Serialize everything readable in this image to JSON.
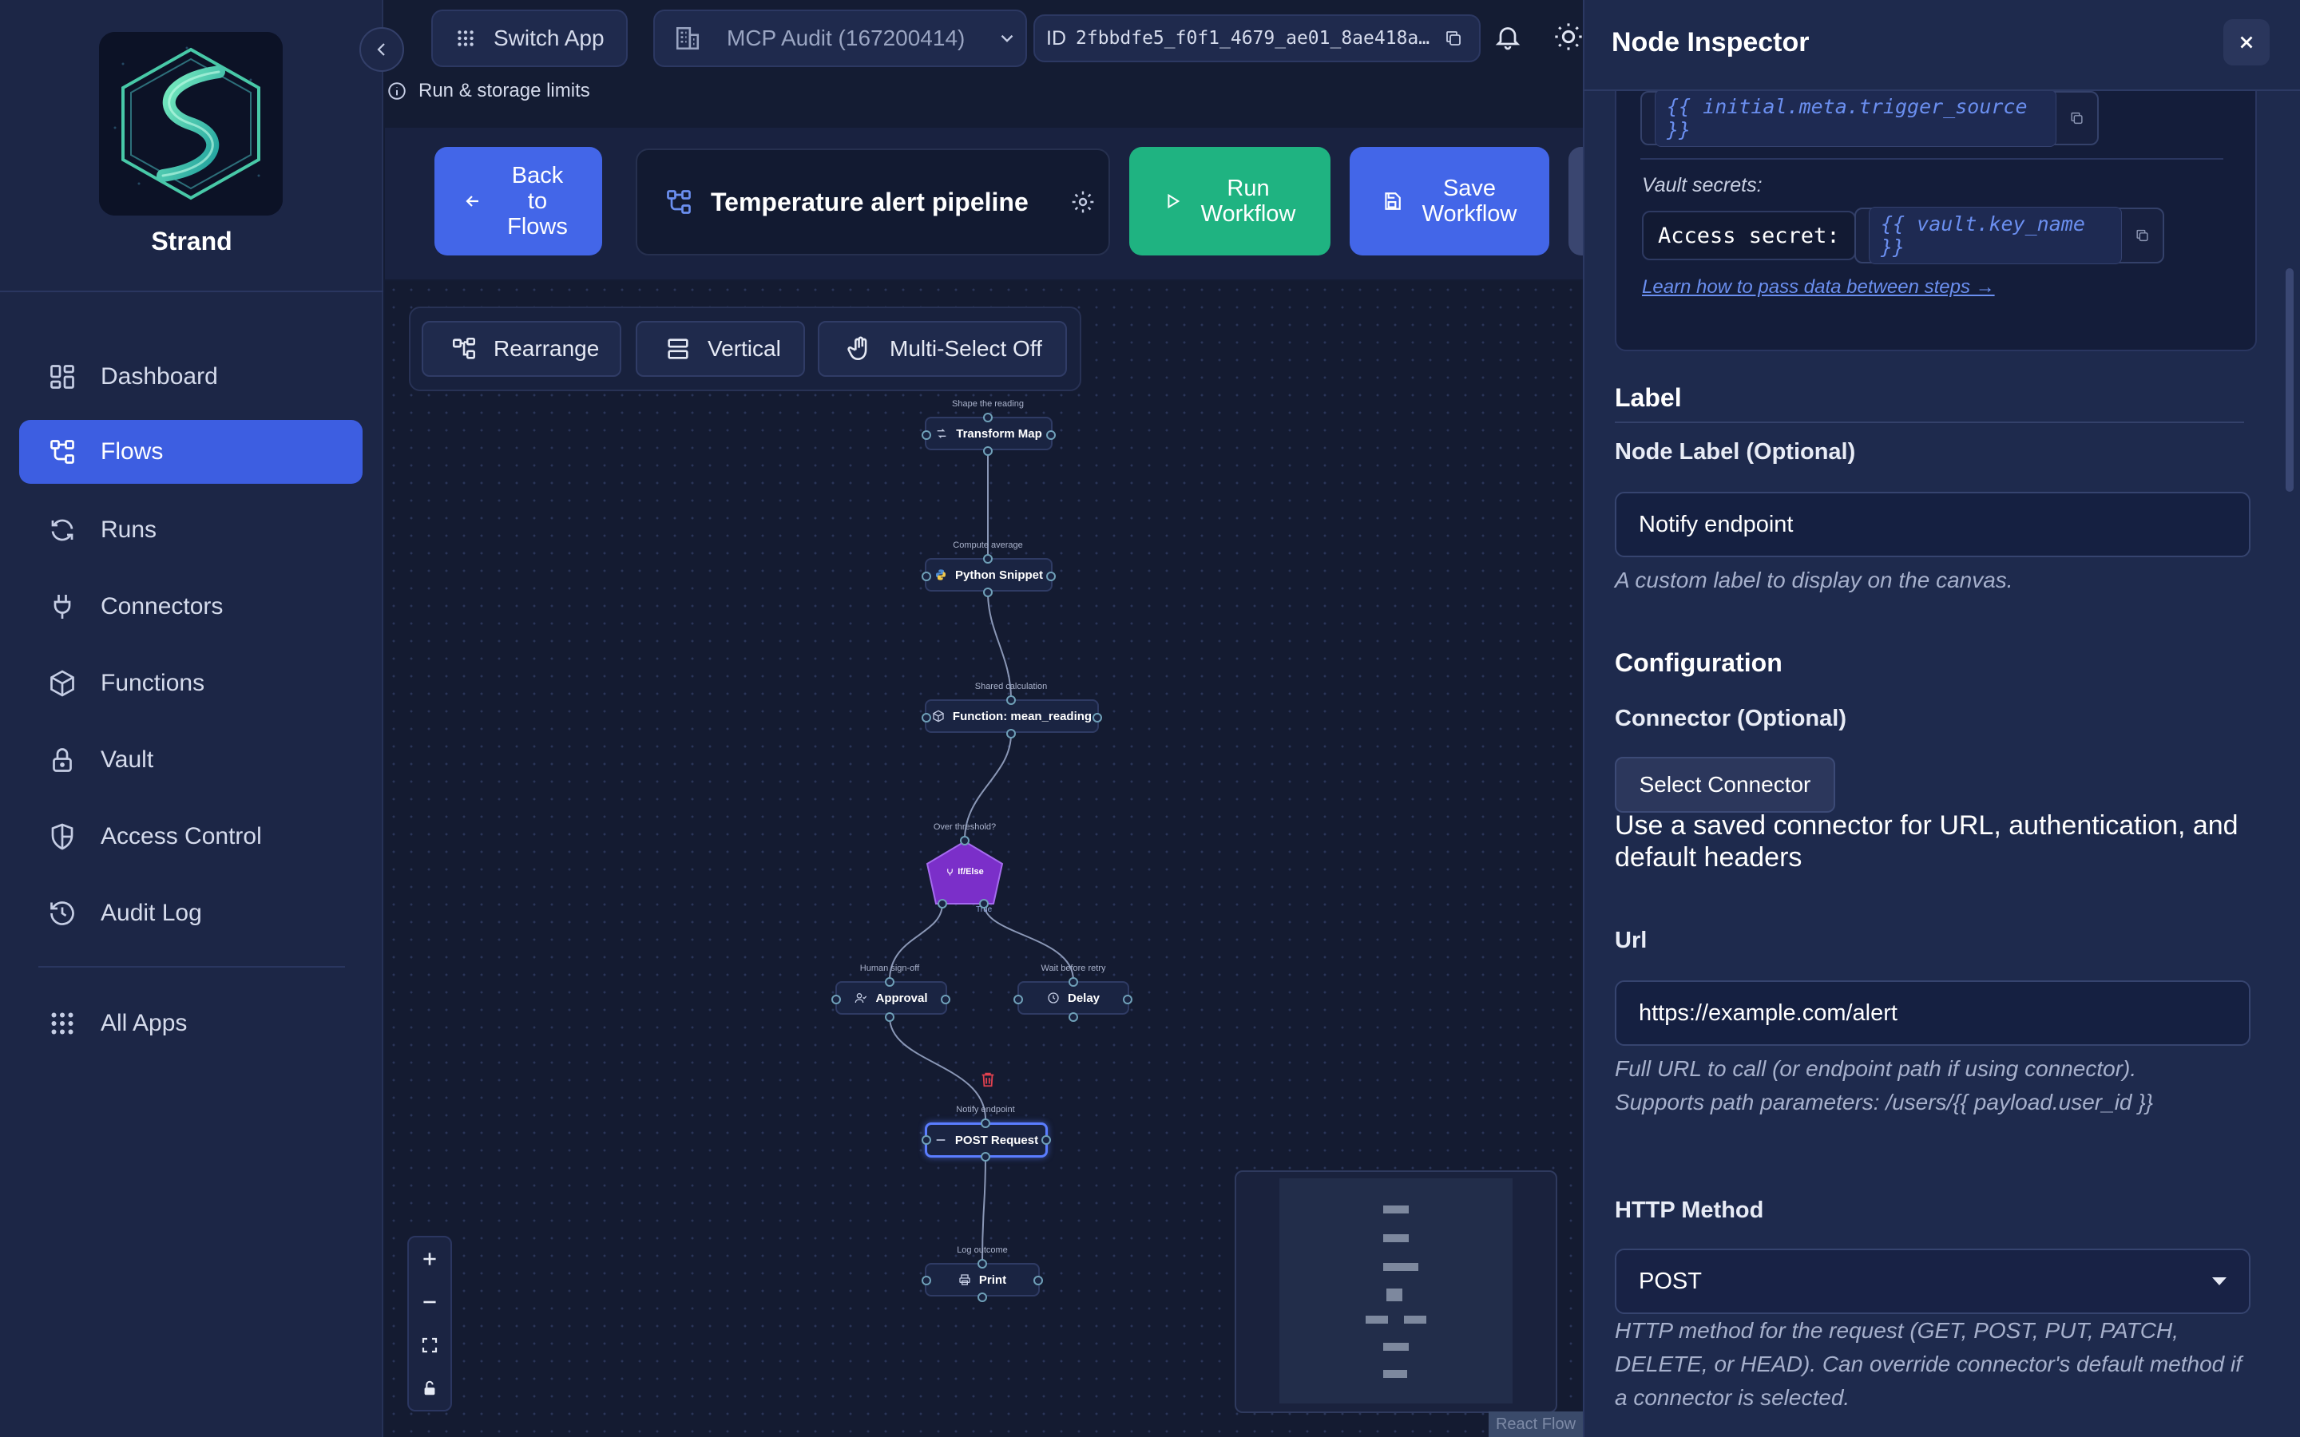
{
  "sidebar": {
    "brand": "Strand",
    "items": [
      {
        "label": "Dashboard",
        "icon": "dashboard-icon"
      },
      {
        "label": "Flows",
        "icon": "flows-icon",
        "active": true
      },
      {
        "label": "Runs",
        "icon": "runs-icon"
      },
      {
        "label": "Connectors",
        "icon": "plug-icon"
      },
      {
        "label": "Functions",
        "icon": "cube-icon"
      },
      {
        "label": "Vault",
        "icon": "lock-icon"
      },
      {
        "label": "Access Control",
        "icon": "shield-icon"
      },
      {
        "label": "Audit Log",
        "icon": "history-icon"
      }
    ],
    "all_apps": "All Apps"
  },
  "topbar": {
    "switch_app": "Switch App",
    "org": "MCP Audit (167200414)",
    "id_label": "ID",
    "id_value": "2fbbdfe5_f0f1_4679_ae01_8ae418a…",
    "limits": "Run & storage limits"
  },
  "header": {
    "back_label": "Back to Flows",
    "flow_title": "Temperature alert pipeline",
    "run_label": "Run Workflow",
    "save_label": "Save Workflow"
  },
  "canvas_toolbar": {
    "rearrange": "Rearrange",
    "vertical": "Vertical",
    "multiselect": "Multi-Select Off"
  },
  "nodes": [
    {
      "caption": "Shape the reading",
      "label": "Transform Map"
    },
    {
      "caption": "Compute average",
      "label": "Python Snippet"
    },
    {
      "caption": "Shared calculation",
      "label": "Function: mean_reading"
    },
    {
      "caption": "Over threshold?",
      "label": "If/Else",
      "true_label": "True"
    },
    {
      "caption": "Human sign-off",
      "label": "Approval"
    },
    {
      "caption": "Wait before retry",
      "label": "Delay"
    },
    {
      "caption": "Notify endpoint",
      "label": "POST Request"
    },
    {
      "caption": "Log outcome",
      "label": "Print"
    }
  ],
  "canvas": {
    "attribution": "React Flow"
  },
  "inspector": {
    "title": "Node Inspector",
    "trigger_source_expr": "{{ initial.meta.trigger_source }}",
    "vault_secrets_label": "Vault secrets:",
    "access_secret_label": "Access secret:",
    "vault_expr": "{{ vault.key_name }}",
    "learn_link": "Learn how to pass data between steps →",
    "label_section": "Label",
    "node_label_title": "Node Label (Optional)",
    "node_label_value": "Notify endpoint",
    "node_label_help": "A custom label to display on the canvas.",
    "config_section": "Configuration",
    "connector_title": "Connector (Optional)",
    "select_connector": "Select Connector",
    "connector_help": "Use a saved connector for URL, authentication, and default headers",
    "url_title": "Url",
    "url_value": "https://example.com/alert",
    "url_help_1": "Full URL to call (or endpoint path if using connector).",
    "url_help_2": "Supports path parameters: /users/{{ payload.user_id }}",
    "method_title": "HTTP Method",
    "method_value": "POST",
    "method_help": "HTTP method for the request (GET, POST, PUT, PATCH, DELETE, or HEAD). Can override connector's default method if a connector is selected."
  },
  "colors": {
    "accent": "#4366e8",
    "run_green": "#1fb381",
    "branch_purple": "#7b2fc9",
    "delete_red": "#e0414f"
  }
}
